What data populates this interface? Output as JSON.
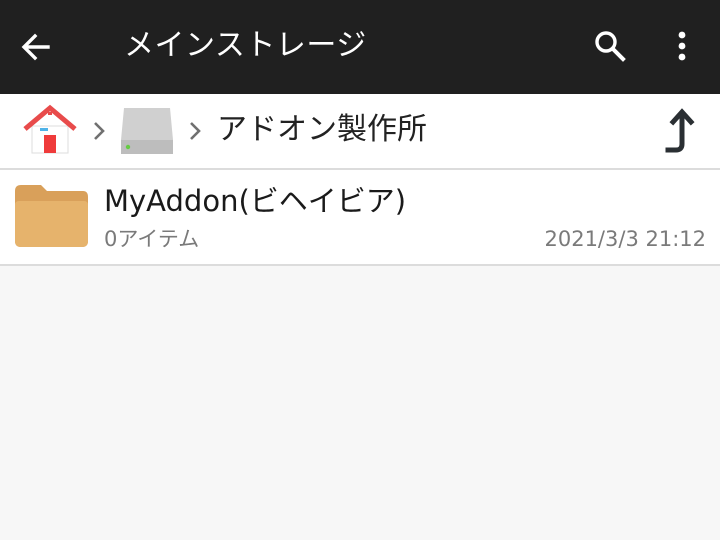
{
  "app": {
    "title": "メインストレージ"
  },
  "toolbar": {
    "back_icon": "arrow-left-icon",
    "search_icon": "search-icon",
    "more_icon": "more-vert-icon"
  },
  "breadcrumb": {
    "items": [
      {
        "icon": "home-icon"
      },
      {
        "icon": "drive-icon"
      },
      {
        "label": "アドオン製作所"
      }
    ],
    "up_icon": "up-arrow-icon"
  },
  "files": [
    {
      "icon": "folder-icon",
      "name": "MyAddon(ビヘイビア)",
      "meta": "0アイテム",
      "date": "2021/3/3 21:12"
    }
  ],
  "colors": {
    "appbar_bg": "#202020",
    "folder": "#e3ac63",
    "home_roof": "#e84b4b",
    "drive": "#d0d0d0"
  }
}
